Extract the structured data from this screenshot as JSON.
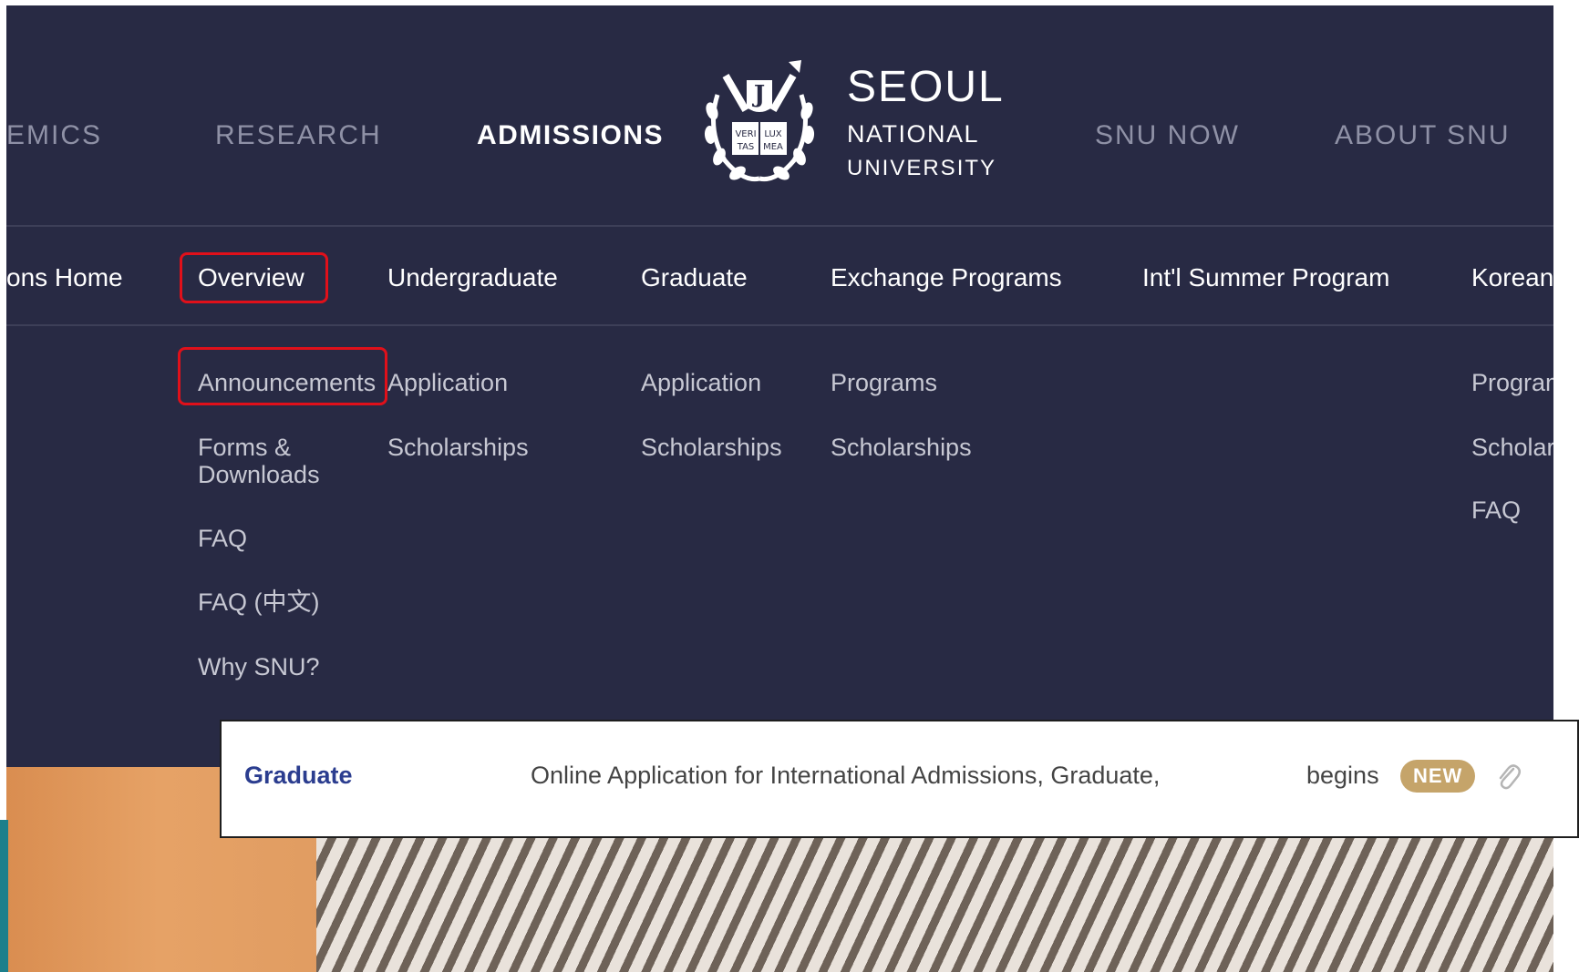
{
  "top_nav": {
    "academics": "EMICS",
    "research": "RESEARCH",
    "admissions": "ADMISSIONS",
    "snu_now": "SNU NOW",
    "about": "ABOUT SNU"
  },
  "logo": {
    "line1": "SEOUL",
    "line2": "NATIONAL",
    "line3": "UNIVERSITY",
    "emblem_text": [
      "VERI",
      "LUX",
      "TAS",
      "MEA"
    ]
  },
  "sub_nav": {
    "home": "ons Home",
    "overview": "Overview",
    "undergraduate": "Undergraduate",
    "graduate": "Graduate",
    "exchange": "Exchange Programs",
    "summer": "Int'l Summer Program",
    "korean": "Korean"
  },
  "dropdown": {
    "overview": [
      "Announcements",
      "Forms &",
      "Downloads",
      "FAQ",
      "FAQ (中文)",
      "Why SNU?"
    ],
    "undergraduate": [
      "Application",
      "Scholarships"
    ],
    "graduate": [
      "Application",
      "Scholarships"
    ],
    "exchange": [
      "Programs",
      "Scholarships"
    ],
    "korean": [
      "Program",
      "Scholar",
      "FAQ"
    ]
  },
  "notice": {
    "category": "Graduate",
    "title": "Online Application for International Admissions, Graduate,",
    "suffix": "begins",
    "badge": "NEW",
    "attachment_icon": "paperclip-icon"
  },
  "colors": {
    "header_bg": "#282a44",
    "highlight": "#e0101a",
    "badge": "#c5a46a",
    "category": "#2b3d8f"
  }
}
